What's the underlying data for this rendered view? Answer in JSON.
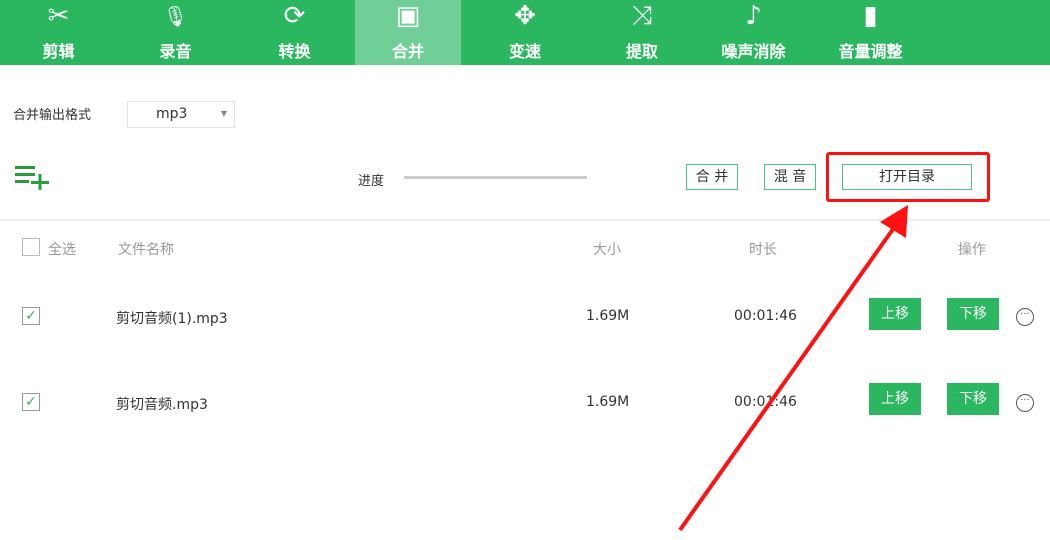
{
  "toolbar": {
    "tabs": [
      {
        "label": "剪辑",
        "icon": "✂"
      },
      {
        "label": "录音",
        "icon": "🎙"
      },
      {
        "label": "转换",
        "icon": "⟳"
      },
      {
        "label": "合并",
        "icon": "▣"
      },
      {
        "label": "变速",
        "icon": "✥"
      },
      {
        "label": "提取",
        "icon": "⤨"
      },
      {
        "label": "噪声消除",
        "icon": "♪"
      },
      {
        "label": "音量调整",
        "icon": "▮"
      }
    ],
    "active": "合并"
  },
  "format": {
    "label": "合并输出格式",
    "value": "mp3"
  },
  "progress": {
    "label": "进度",
    "value": 0
  },
  "buttons": {
    "merge": "合 并",
    "mix": "混 音",
    "open_dir": "打开目录"
  },
  "table": {
    "select_all": "全选",
    "columns": [
      "文件名称",
      "大小",
      "时长",
      "操作"
    ],
    "rows": [
      {
        "name": "剪切音频(1).mp3",
        "size": "1.69M",
        "duration": "00:01:46",
        "checked": true
      },
      {
        "name": "剪切音频.mp3",
        "size": "1.69M",
        "duration": "00:01:46",
        "checked": true
      }
    ],
    "up": "上移",
    "down": "下移"
  },
  "colors": {
    "brand": "#2bb760",
    "highlight": "#ff1111"
  }
}
